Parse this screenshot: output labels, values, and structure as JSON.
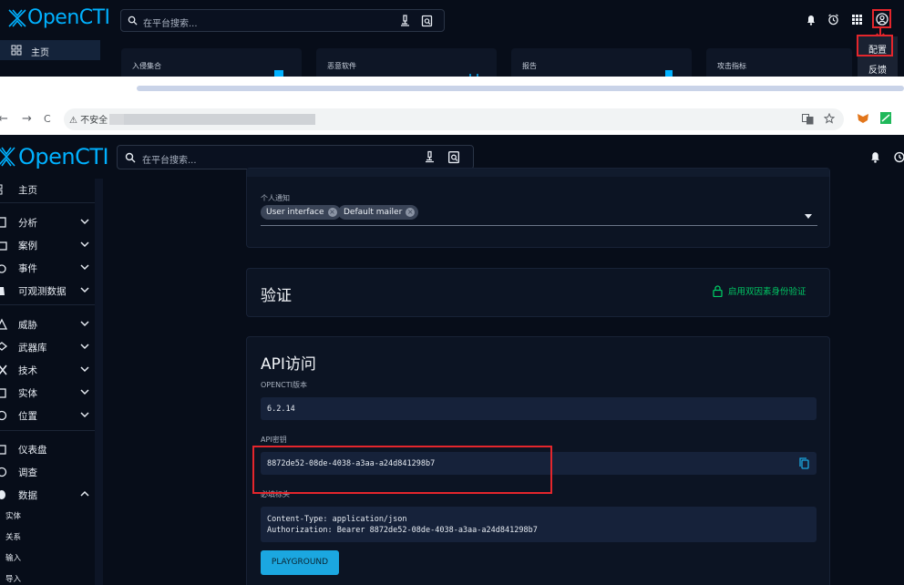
{
  "top_strip": {
    "brand": "OpenCTI",
    "search_placeholder": "在平台搜索...",
    "sidebar_home": "主页",
    "cards": [
      "入侵集合",
      "恶意软件",
      "报告",
      "攻击指标"
    ],
    "dropdown_items": [
      "配置",
      "反馈"
    ]
  },
  "browser": {
    "back": "←",
    "forward": "→",
    "reload": "C",
    "security_label": "⚠ 不安全"
  },
  "app": {
    "brand": "OpenCTI",
    "search_placeholder": "在平台搜索..."
  },
  "sidebar": {
    "items": [
      {
        "label": "主页",
        "icon": "dashboard-icon",
        "chevron": "none"
      },
      {
        "label": "分析",
        "icon": "book-icon",
        "chevron": "down"
      },
      {
        "label": "案例",
        "icon": "briefcase-icon",
        "chevron": "down"
      },
      {
        "label": "事件",
        "icon": "shield-alert-icon",
        "chevron": "down"
      },
      {
        "label": "可观测数据",
        "icon": "binoculars-icon",
        "chevron": "down"
      },
      {
        "label": "威胁",
        "icon": "warning-icon",
        "chevron": "down"
      },
      {
        "label": "武器库",
        "icon": "layers-icon",
        "chevron": "down"
      },
      {
        "label": "技术",
        "icon": "tools-icon",
        "chevron": "down"
      },
      {
        "label": "实体",
        "icon": "database-icon",
        "chevron": "down"
      },
      {
        "label": "位置",
        "icon": "globe-icon",
        "chevron": "down"
      },
      {
        "label": "仪表盘",
        "icon": "chart-icon",
        "chevron": "none"
      },
      {
        "label": "调查",
        "icon": "compass-icon",
        "chevron": "none"
      },
      {
        "label": "数据",
        "icon": "data-icon",
        "chevron": "up"
      }
    ],
    "sub_items": [
      "实体",
      "关系",
      "输入",
      "导入"
    ]
  },
  "notifications_panel": {
    "label": "个人通知",
    "chips": [
      "User interface",
      "Default mailer"
    ]
  },
  "auth_panel": {
    "title": "验证",
    "action": "启用双因素身份验证"
  },
  "api_panel": {
    "title": "API访问",
    "version_label": "OPENCTI版本",
    "version_value": "6.2.14",
    "token_label": "API密钥",
    "token_value": "8872de52-08de-4038-a3aa-a24d841298b7",
    "headers_label": "必填标头",
    "headers_line1": "Content-Type: application/json",
    "headers_line2": "Authorization: Bearer 8872de52-08de-4038-a3aa-a24d841298b7",
    "playground": "PLAYGROUND"
  },
  "colors": {
    "background": "#070d19",
    "brand": "#00b1ff",
    "accent_green": "#00c864",
    "highlight_red": "#e4262c",
    "button_blue": "#1ba7e0"
  }
}
